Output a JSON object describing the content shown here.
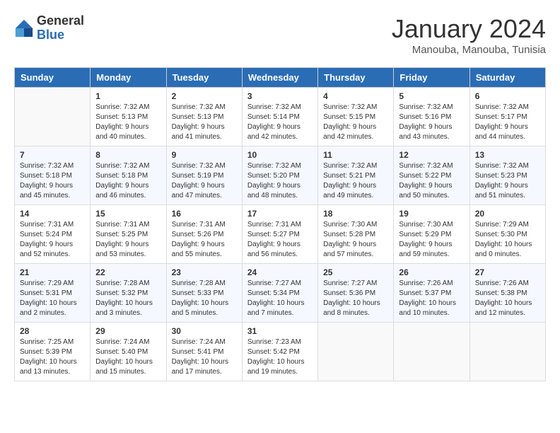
{
  "header": {
    "logo_general": "General",
    "logo_blue": "Blue",
    "month_title": "January 2024",
    "location": "Manouba, Manouba, Tunisia"
  },
  "days_of_week": [
    "Sunday",
    "Monday",
    "Tuesday",
    "Wednesday",
    "Thursday",
    "Friday",
    "Saturday"
  ],
  "weeks": [
    [
      {
        "day": "",
        "sunrise": "",
        "sunset": "",
        "daylight": ""
      },
      {
        "day": "1",
        "sunrise": "Sunrise: 7:32 AM",
        "sunset": "Sunset: 5:13 PM",
        "daylight": "Daylight: 9 hours and 40 minutes."
      },
      {
        "day": "2",
        "sunrise": "Sunrise: 7:32 AM",
        "sunset": "Sunset: 5:13 PM",
        "daylight": "Daylight: 9 hours and 41 minutes."
      },
      {
        "day": "3",
        "sunrise": "Sunrise: 7:32 AM",
        "sunset": "Sunset: 5:14 PM",
        "daylight": "Daylight: 9 hours and 42 minutes."
      },
      {
        "day": "4",
        "sunrise": "Sunrise: 7:32 AM",
        "sunset": "Sunset: 5:15 PM",
        "daylight": "Daylight: 9 hours and 42 minutes."
      },
      {
        "day": "5",
        "sunrise": "Sunrise: 7:32 AM",
        "sunset": "Sunset: 5:16 PM",
        "daylight": "Daylight: 9 hours and 43 minutes."
      },
      {
        "day": "6",
        "sunrise": "Sunrise: 7:32 AM",
        "sunset": "Sunset: 5:17 PM",
        "daylight": "Daylight: 9 hours and 44 minutes."
      }
    ],
    [
      {
        "day": "7",
        "sunrise": "Sunrise: 7:32 AM",
        "sunset": "Sunset: 5:18 PM",
        "daylight": "Daylight: 9 hours and 45 minutes."
      },
      {
        "day": "8",
        "sunrise": "Sunrise: 7:32 AM",
        "sunset": "Sunset: 5:18 PM",
        "daylight": "Daylight: 9 hours and 46 minutes."
      },
      {
        "day": "9",
        "sunrise": "Sunrise: 7:32 AM",
        "sunset": "Sunset: 5:19 PM",
        "daylight": "Daylight: 9 hours and 47 minutes."
      },
      {
        "day": "10",
        "sunrise": "Sunrise: 7:32 AM",
        "sunset": "Sunset: 5:20 PM",
        "daylight": "Daylight: 9 hours and 48 minutes."
      },
      {
        "day": "11",
        "sunrise": "Sunrise: 7:32 AM",
        "sunset": "Sunset: 5:21 PM",
        "daylight": "Daylight: 9 hours and 49 minutes."
      },
      {
        "day": "12",
        "sunrise": "Sunrise: 7:32 AM",
        "sunset": "Sunset: 5:22 PM",
        "daylight": "Daylight: 9 hours and 50 minutes."
      },
      {
        "day": "13",
        "sunrise": "Sunrise: 7:32 AM",
        "sunset": "Sunset: 5:23 PM",
        "daylight": "Daylight: 9 hours and 51 minutes."
      }
    ],
    [
      {
        "day": "14",
        "sunrise": "Sunrise: 7:31 AM",
        "sunset": "Sunset: 5:24 PM",
        "daylight": "Daylight: 9 hours and 52 minutes."
      },
      {
        "day": "15",
        "sunrise": "Sunrise: 7:31 AM",
        "sunset": "Sunset: 5:25 PM",
        "daylight": "Daylight: 9 hours and 53 minutes."
      },
      {
        "day": "16",
        "sunrise": "Sunrise: 7:31 AM",
        "sunset": "Sunset: 5:26 PM",
        "daylight": "Daylight: 9 hours and 55 minutes."
      },
      {
        "day": "17",
        "sunrise": "Sunrise: 7:31 AM",
        "sunset": "Sunset: 5:27 PM",
        "daylight": "Daylight: 9 hours and 56 minutes."
      },
      {
        "day": "18",
        "sunrise": "Sunrise: 7:30 AM",
        "sunset": "Sunset: 5:28 PM",
        "daylight": "Daylight: 9 hours and 57 minutes."
      },
      {
        "day": "19",
        "sunrise": "Sunrise: 7:30 AM",
        "sunset": "Sunset: 5:29 PM",
        "daylight": "Daylight: 9 hours and 59 minutes."
      },
      {
        "day": "20",
        "sunrise": "Sunrise: 7:29 AM",
        "sunset": "Sunset: 5:30 PM",
        "daylight": "Daylight: 10 hours and 0 minutes."
      }
    ],
    [
      {
        "day": "21",
        "sunrise": "Sunrise: 7:29 AM",
        "sunset": "Sunset: 5:31 PM",
        "daylight": "Daylight: 10 hours and 2 minutes."
      },
      {
        "day": "22",
        "sunrise": "Sunrise: 7:28 AM",
        "sunset": "Sunset: 5:32 PM",
        "daylight": "Daylight: 10 hours and 3 minutes."
      },
      {
        "day": "23",
        "sunrise": "Sunrise: 7:28 AM",
        "sunset": "Sunset: 5:33 PM",
        "daylight": "Daylight: 10 hours and 5 minutes."
      },
      {
        "day": "24",
        "sunrise": "Sunrise: 7:27 AM",
        "sunset": "Sunset: 5:34 PM",
        "daylight": "Daylight: 10 hours and 7 minutes."
      },
      {
        "day": "25",
        "sunrise": "Sunrise: 7:27 AM",
        "sunset": "Sunset: 5:36 PM",
        "daylight": "Daylight: 10 hours and 8 minutes."
      },
      {
        "day": "26",
        "sunrise": "Sunrise: 7:26 AM",
        "sunset": "Sunset: 5:37 PM",
        "daylight": "Daylight: 10 hours and 10 minutes."
      },
      {
        "day": "27",
        "sunrise": "Sunrise: 7:26 AM",
        "sunset": "Sunset: 5:38 PM",
        "daylight": "Daylight: 10 hours and 12 minutes."
      }
    ],
    [
      {
        "day": "28",
        "sunrise": "Sunrise: 7:25 AM",
        "sunset": "Sunset: 5:39 PM",
        "daylight": "Daylight: 10 hours and 13 minutes."
      },
      {
        "day": "29",
        "sunrise": "Sunrise: 7:24 AM",
        "sunset": "Sunset: 5:40 PM",
        "daylight": "Daylight: 10 hours and 15 minutes."
      },
      {
        "day": "30",
        "sunrise": "Sunrise: 7:24 AM",
        "sunset": "Sunset: 5:41 PM",
        "daylight": "Daylight: 10 hours and 17 minutes."
      },
      {
        "day": "31",
        "sunrise": "Sunrise: 7:23 AM",
        "sunset": "Sunset: 5:42 PM",
        "daylight": "Daylight: 10 hours and 19 minutes."
      },
      {
        "day": "",
        "sunrise": "",
        "sunset": "",
        "daylight": ""
      },
      {
        "day": "",
        "sunrise": "",
        "sunset": "",
        "daylight": ""
      },
      {
        "day": "",
        "sunrise": "",
        "sunset": "",
        "daylight": ""
      }
    ]
  ]
}
